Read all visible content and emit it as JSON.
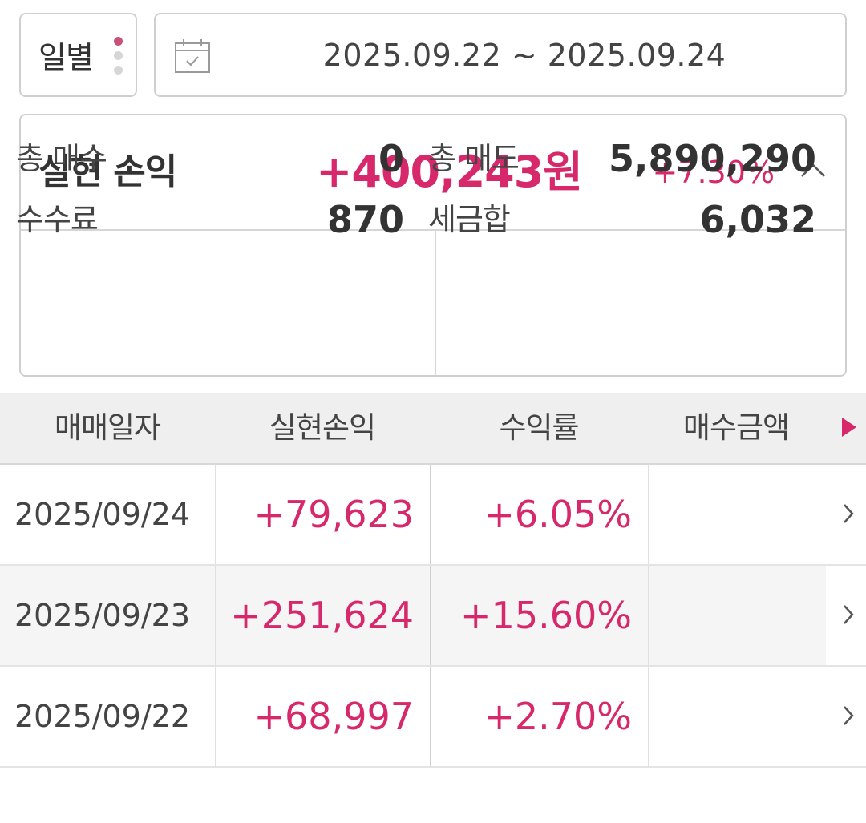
{
  "filter": {
    "period_label": "일별",
    "date_range": "2025.09.22 ~ 2025.09.24"
  },
  "summary": {
    "title": "실현 손익",
    "amount": "+400,243원",
    "rate": "+7.30%",
    "stats": {
      "total_buy_label": "총 매수",
      "total_buy_value": "0",
      "total_sell_label": "총 매도",
      "total_sell_value": "5,890,290",
      "fee_label": "수수료",
      "fee_value": "870",
      "tax_label": "세금합",
      "tax_value": "6,032"
    }
  },
  "table": {
    "headers": [
      "매매일자",
      "실현손익",
      "수익률",
      "매수금액"
    ],
    "rows": [
      {
        "date": "2025/09/24",
        "pl": "+79,623",
        "rate": "+6.05%"
      },
      {
        "date": "2025/09/23",
        "pl": "+251,624",
        "rate": "+15.60%"
      },
      {
        "date": "2025/09/22",
        "pl": "+68,997",
        "rate": "+2.70%"
      }
    ]
  },
  "colors": {
    "accent": "#d6286a",
    "menu_dot_active": "#c8517b",
    "header_bg": "#efefef",
    "border": "#cfcfcf"
  },
  "icons": {
    "period_menu": "kebab-dots-icon",
    "calendar": "calendar-icon",
    "collapse": "chevron-up-icon",
    "scroll_right": "triangle-right-icon",
    "row_detail": "chevron-right-icon"
  }
}
